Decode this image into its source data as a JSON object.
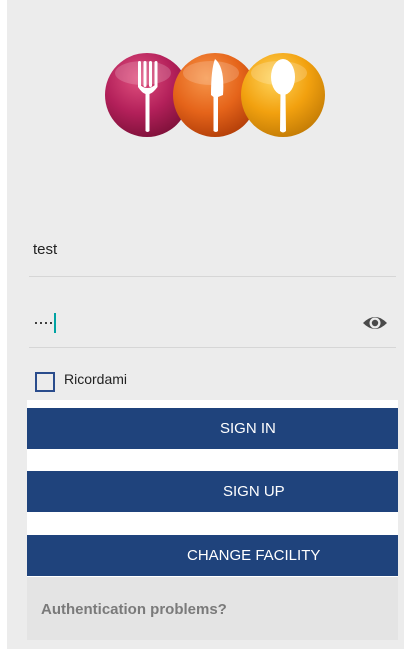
{
  "login": {
    "username_value": "test",
    "password_masked": "····",
    "remember_label": "Ricordami",
    "remember_checked": false
  },
  "buttons": {
    "sign_in": "SIGN IN",
    "sign_up": "SIGN UP",
    "change_facility": "CHANGE FACILITY"
  },
  "links": {
    "auth_problems": "Authentication problems?"
  },
  "icons": {
    "logo_fork": "fork-icon",
    "logo_knife": "knife-icon",
    "logo_spoon": "spoon-icon",
    "password_toggle": "eye-icon"
  },
  "colors": {
    "primary_button": "#1f437c",
    "checkbox_border": "#2a4c8c",
    "caret": "#00a3a3",
    "logo_fork_circle": "#a61e55",
    "logo_knife_circle": "#e5641a",
    "logo_spoon_circle": "#f2a10f"
  }
}
